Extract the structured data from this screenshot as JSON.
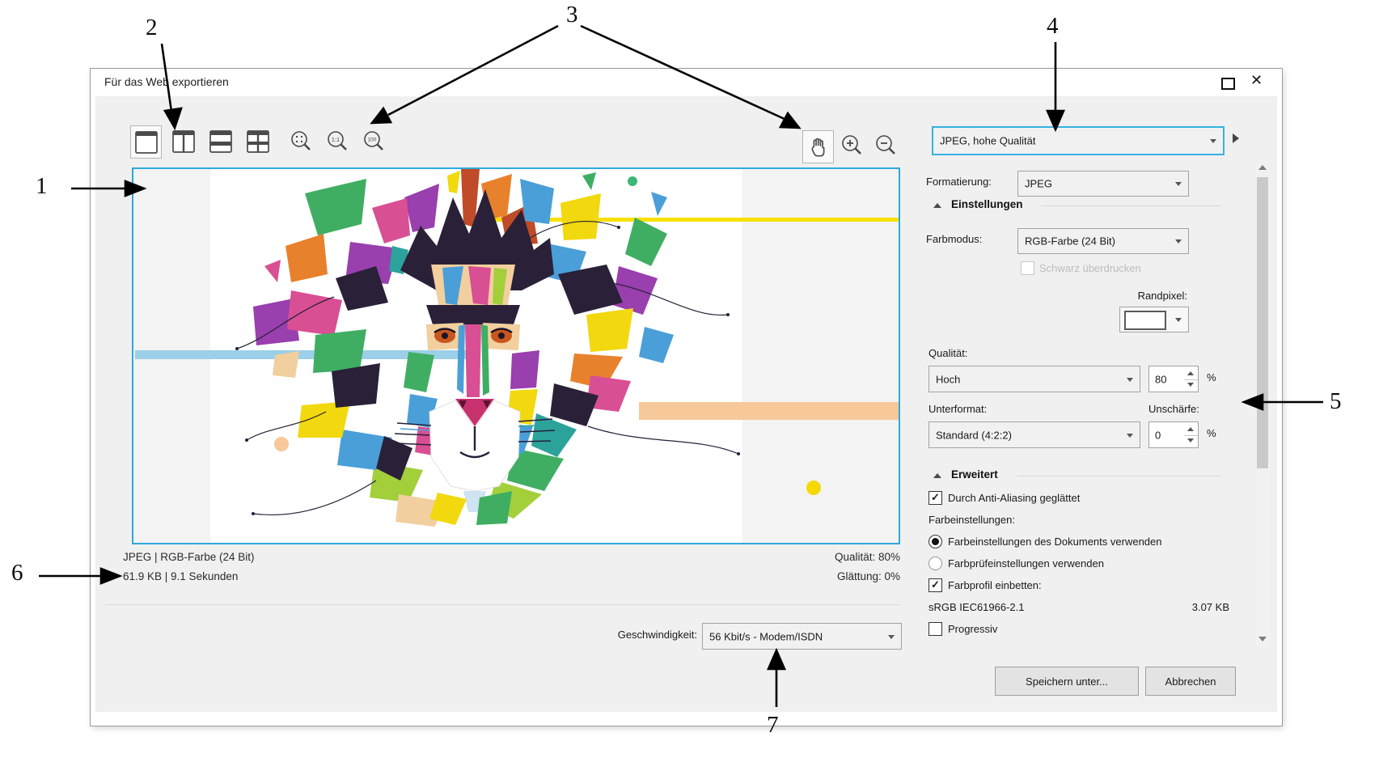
{
  "window": {
    "title": "Für das Web exportieren"
  },
  "icons": {
    "close": "✕",
    "check": "✓"
  },
  "preset": {
    "value": "JPEG, hohe Qualität"
  },
  "panel": {
    "format_label": "Formatierung:",
    "format_value": "JPEG",
    "settings_header": "Einstellungen",
    "colormode_label": "Farbmodus:",
    "colormode_value": "RGB-Farbe (24 Bit)",
    "overprint_label": "Schwarz überdrucken",
    "edgepixel_label": "Randpixel:",
    "quality_label": "Qualität:",
    "quality_value": "Hoch",
    "quality_percent": "80",
    "subformat_label": "Unterformat:",
    "subformat_value": "Standard (4:2:2)",
    "blur_label": "Unschärfe:",
    "blur_value": "0",
    "percent": "%",
    "advanced_header": "Erweitert",
    "antialias_label": "Durch Anti-Aliasing geglättet",
    "colorsettings_label": "Farbeinstellungen:",
    "radio_document": "Farbeinstellungen des Dokuments verwenden",
    "radio_proof": "Farbprüfeinstellungen verwenden",
    "embed_label": "Farbprofil einbetten:",
    "profile_name": "sRGB IEC61966-2.1",
    "profile_size": "3.07 KB",
    "progressive_label": "Progressiv"
  },
  "status": {
    "line1": "JPEG  |  RGB-Farbe (24 Bit)",
    "line2": "61.9 KB  |  9.1 Sekunden",
    "right1": "Qualität: 80%",
    "right2": "Glättung: 0%"
  },
  "speed": {
    "label": "Geschwindigkeit:",
    "value": "56 Kbit/s - Modem/ISDN"
  },
  "buttons": {
    "save": "Speichern unter...",
    "cancel": "Abbrechen"
  },
  "colors": {
    "accent": "#2fa8dc",
    "focus": "#35b2e0"
  },
  "annotations": [
    {
      "label": "1"
    },
    {
      "label": "2"
    },
    {
      "label": "3"
    },
    {
      "label": "4"
    },
    {
      "label": "5"
    },
    {
      "label": "6"
    },
    {
      "label": "7"
    }
  ]
}
